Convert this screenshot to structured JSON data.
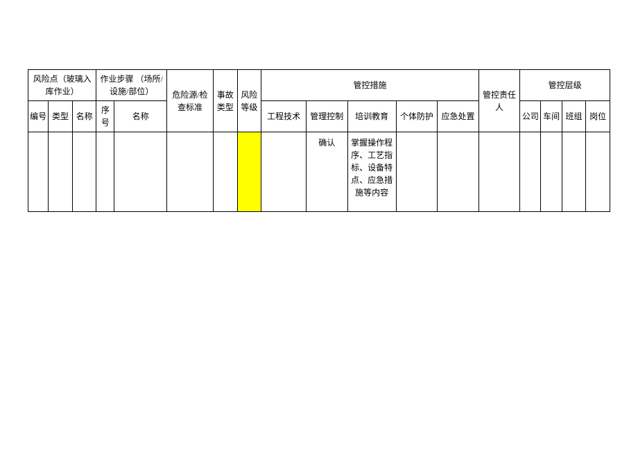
{
  "headers": {
    "risk_point": "风险点（玻璃入库作业）",
    "work_steps": "作业步骤\n（场所/设施/部位）",
    "hazard_source": "危险源/检查标准",
    "accident_type": "事故类型",
    "risk_level": "风险等级",
    "control_measures": "管控措施",
    "responsible_person": "管控责任人",
    "control_level": "管控层级",
    "sub": {
      "seq_no": "编号",
      "type": "类型",
      "name": "名称",
      "step_no": "序号",
      "step_name": "名称",
      "eng_tech": "工程技术",
      "mgmt_control": "管理控制",
      "training": "培训教育",
      "ppe": "个体防护",
      "emergency": "应急处置",
      "company": "公司",
      "workshop": "车间",
      "team": "班组",
      "post": "岗位"
    }
  },
  "rows": [
    {
      "seq_no": "",
      "type": "",
      "name": "",
      "step_no": "",
      "step_name": "",
      "hazard_source": "",
      "accident_type": "",
      "risk_level": "",
      "eng_tech": "",
      "mgmt_control": "确认",
      "training": "掌握操作程序、工艺指标、设备特点、应急措施等内容",
      "ppe": "",
      "emergency": "",
      "responsible_person": "",
      "company": "",
      "workshop": "",
      "team": "",
      "post": ""
    }
  ]
}
